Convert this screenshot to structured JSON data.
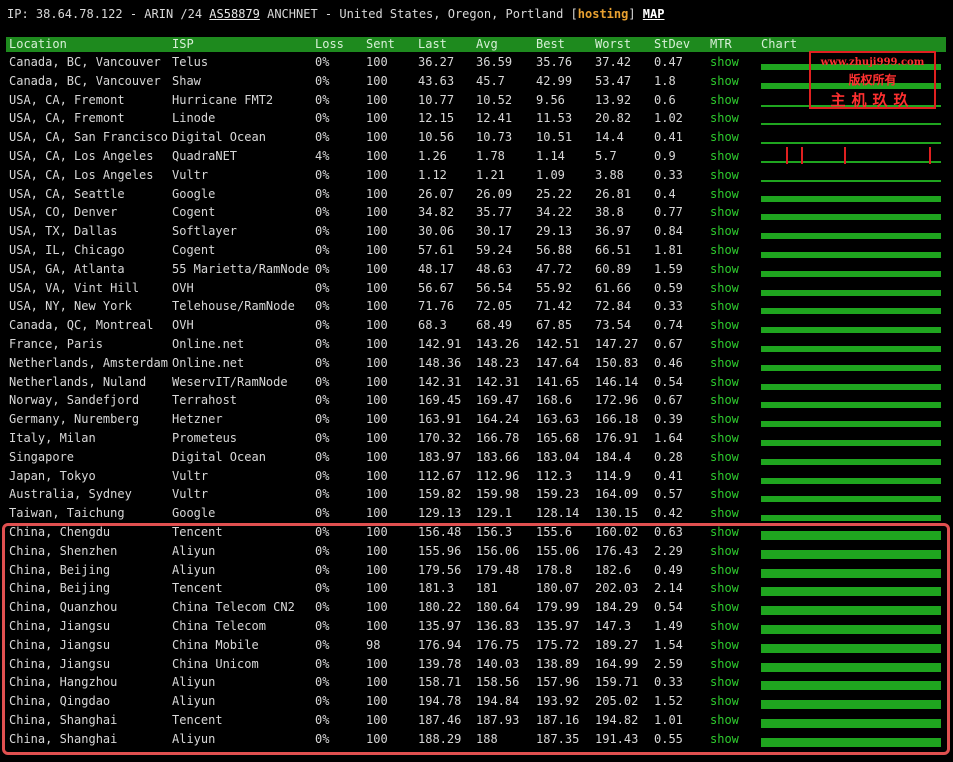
{
  "topline": {
    "prefix": "IP: 38.64.78.122 - ARIN /24 ",
    "asn": "AS58879",
    "mid": " ANCHNET - United States, Oregon, Portland [",
    "tag": "hosting",
    "close": "] ",
    "map": "MAP"
  },
  "headers": {
    "location": "Location",
    "isp": "ISP",
    "loss": "Loss",
    "sent": "Sent",
    "last": "Last",
    "avg": "Avg",
    "best": "Best",
    "worst": "Worst",
    "stdev": "StDev",
    "mtr": "MTR",
    "chart": "Chart"
  },
  "rows": [
    {
      "location": "Canada, BC, Vancouver",
      "isp": "Telus",
      "loss": "0%",
      "sent": "100",
      "last": "36.27",
      "avg": "36.59",
      "best": "35.76",
      "worst": "37.42",
      "stdev": "0.47",
      "mtr": "show"
    },
    {
      "location": "Canada, BC, Vancouver",
      "isp": "Shaw",
      "loss": "0%",
      "sent": "100",
      "last": "43.63",
      "avg": "45.7",
      "best": "42.99",
      "worst": "53.47",
      "stdev": "1.8",
      "mtr": "show"
    },
    {
      "location": "USA, CA, Fremont",
      "isp": "Hurricane FMT2",
      "loss": "0%",
      "sent": "100",
      "last": "10.77",
      "avg": "10.52",
      "best": "9.56",
      "worst": "13.92",
      "stdev": "0.6",
      "mtr": "show"
    },
    {
      "location": "USA, CA, Fremont",
      "isp": "Linode",
      "loss": "0%",
      "sent": "100",
      "last": "12.15",
      "avg": "12.41",
      "best": "11.53",
      "worst": "20.82",
      "stdev": "1.02",
      "mtr": "show"
    },
    {
      "location": "USA, CA, San Francisco",
      "isp": "Digital Ocean",
      "loss": "0%",
      "sent": "100",
      "last": "10.56",
      "avg": "10.73",
      "best": "10.51",
      "worst": "14.4",
      "stdev": "0.41",
      "mtr": "show"
    },
    {
      "location": "USA, CA, Los Angeles",
      "isp": "QuadraNET",
      "loss": "4%",
      "sent": "100",
      "last": "1.26",
      "avg": "1.78",
      "best": "1.14",
      "worst": "5.7",
      "stdev": "0.9",
      "mtr": "show"
    },
    {
      "location": "USA, CA, Los Angeles",
      "isp": "Vultr",
      "loss": "0%",
      "sent": "100",
      "last": "1.12",
      "avg": "1.21",
      "best": "1.09",
      "worst": "3.88",
      "stdev": "0.33",
      "mtr": "show"
    },
    {
      "location": "USA, CA, Seattle",
      "isp": "Google",
      "loss": "0%",
      "sent": "100",
      "last": "26.07",
      "avg": "26.09",
      "best": "25.22",
      "worst": "26.81",
      "stdev": "0.4",
      "mtr": "show"
    },
    {
      "location": "USA, CO, Denver",
      "isp": "Cogent",
      "loss": "0%",
      "sent": "100",
      "last": "34.82",
      "avg": "35.77",
      "best": "34.22",
      "worst": "38.8",
      "stdev": "0.77",
      "mtr": "show"
    },
    {
      "location": "USA, TX, Dallas",
      "isp": "Softlayer",
      "loss": "0%",
      "sent": "100",
      "last": "30.06",
      "avg": "30.17",
      "best": "29.13",
      "worst": "36.97",
      "stdev": "0.84",
      "mtr": "show"
    },
    {
      "location": "USA, IL, Chicago",
      "isp": "Cogent",
      "loss": "0%",
      "sent": "100",
      "last": "57.61",
      "avg": "59.24",
      "best": "56.88",
      "worst": "66.51",
      "stdev": "1.81",
      "mtr": "show"
    },
    {
      "location": "USA, GA, Atlanta",
      "isp": "55 Marietta/RamNode",
      "loss": "0%",
      "sent": "100",
      "last": "48.17",
      "avg": "48.63",
      "best": "47.72",
      "worst": "60.89",
      "stdev": "1.59",
      "mtr": "show"
    },
    {
      "location": "USA, VA, Vint Hill",
      "isp": "OVH",
      "loss": "0%",
      "sent": "100",
      "last": "56.67",
      "avg": "56.54",
      "best": "55.92",
      "worst": "61.66",
      "stdev": "0.59",
      "mtr": "show"
    },
    {
      "location": "USA, NY, New York",
      "isp": "Telehouse/RamNode",
      "loss": "0%",
      "sent": "100",
      "last": "71.76",
      "avg": "72.05",
      "best": "71.42",
      "worst": "72.84",
      "stdev": "0.33",
      "mtr": "show"
    },
    {
      "location": "Canada, QC, Montreal",
      "isp": "OVH",
      "loss": "0%",
      "sent": "100",
      "last": "68.3",
      "avg": "68.49",
      "best": "67.85",
      "worst": "73.54",
      "stdev": "0.74",
      "mtr": "show"
    },
    {
      "location": "France, Paris",
      "isp": "Online.net",
      "loss": "0%",
      "sent": "100",
      "last": "142.91",
      "avg": "143.26",
      "best": "142.51",
      "worst": "147.27",
      "stdev": "0.67",
      "mtr": "show"
    },
    {
      "location": "Netherlands, Amsterdam",
      "isp": "Online.net",
      "loss": "0%",
      "sent": "100",
      "last": "148.36",
      "avg": "148.23",
      "best": "147.64",
      "worst": "150.83",
      "stdev": "0.46",
      "mtr": "show"
    },
    {
      "location": "Netherlands, Nuland",
      "isp": "WeservIT/RamNode",
      "loss": "0%",
      "sent": "100",
      "last": "142.31",
      "avg": "142.31",
      "best": "141.65",
      "worst": "146.14",
      "stdev": "0.54",
      "mtr": "show"
    },
    {
      "location": "Norway, Sandefjord",
      "isp": "Terrahost",
      "loss": "0%",
      "sent": "100",
      "last": "169.45",
      "avg": "169.47",
      "best": "168.6",
      "worst": "172.96",
      "stdev": "0.67",
      "mtr": "show"
    },
    {
      "location": "Germany, Nuremberg",
      "isp": "Hetzner",
      "loss": "0%",
      "sent": "100",
      "last": "163.91",
      "avg": "164.24",
      "best": "163.63",
      "worst": "166.18",
      "stdev": "0.39",
      "mtr": "show"
    },
    {
      "location": "Italy, Milan",
      "isp": "Prometeus",
      "loss": "0%",
      "sent": "100",
      "last": "170.32",
      "avg": "166.78",
      "best": "165.68",
      "worst": "176.91",
      "stdev": "1.64",
      "mtr": "show"
    },
    {
      "location": "Singapore",
      "isp": "Digital Ocean",
      "loss": "0%",
      "sent": "100",
      "last": "183.97",
      "avg": "183.66",
      "best": "183.04",
      "worst": "184.4",
      "stdev": "0.28",
      "mtr": "show"
    },
    {
      "location": "Japan, Tokyo",
      "isp": "Vultr",
      "loss": "0%",
      "sent": "100",
      "last": "112.67",
      "avg": "112.96",
      "best": "112.3",
      "worst": "114.9",
      "stdev": "0.41",
      "mtr": "show"
    },
    {
      "location": "Australia, Sydney",
      "isp": "Vultr",
      "loss": "0%",
      "sent": "100",
      "last": "159.82",
      "avg": "159.98",
      "best": "159.23",
      "worst": "164.09",
      "stdev": "0.57",
      "mtr": "show"
    },
    {
      "location": "Taiwan, Taichung",
      "isp": "Google",
      "loss": "0%",
      "sent": "100",
      "last": "129.13",
      "avg": "129.1",
      "best": "128.14",
      "worst": "130.15",
      "stdev": "0.42",
      "mtr": "show"
    },
    {
      "location": "China, Chengdu",
      "isp": "Tencent",
      "loss": "0%",
      "sent": "100",
      "last": "156.48",
      "avg": "156.3",
      "best": "155.6",
      "worst": "160.02",
      "stdev": "0.63",
      "mtr": "show"
    },
    {
      "location": "China, Shenzhen",
      "isp": "Aliyun",
      "loss": "0%",
      "sent": "100",
      "last": "155.96",
      "avg": "156.06",
      "best": "155.06",
      "worst": "176.43",
      "stdev": "2.29",
      "mtr": "show"
    },
    {
      "location": "China, Beijing",
      "isp": "Aliyun",
      "loss": "0%",
      "sent": "100",
      "last": "179.56",
      "avg": "179.48",
      "best": "178.8",
      "worst": "182.6",
      "stdev": "0.49",
      "mtr": "show"
    },
    {
      "location": "China, Beijing",
      "isp": "Tencent",
      "loss": "0%",
      "sent": "100",
      "last": "181.3",
      "avg": "181",
      "best": "180.07",
      "worst": "202.03",
      "stdev": "2.14",
      "mtr": "show"
    },
    {
      "location": "China, Quanzhou",
      "isp": "China Telecom CN2",
      "loss": "0%",
      "sent": "100",
      "last": "180.22",
      "avg": "180.64",
      "best": "179.99",
      "worst": "184.29",
      "stdev": "0.54",
      "mtr": "show"
    },
    {
      "location": "China, Jiangsu",
      "isp": "China Telecom",
      "loss": "0%",
      "sent": "100",
      "last": "135.97",
      "avg": "136.83",
      "best": "135.97",
      "worst": "147.3",
      "stdev": "1.49",
      "mtr": "show"
    },
    {
      "location": "China, Jiangsu",
      "isp": "China Mobile",
      "loss": "0%",
      "sent": "98",
      "last": "176.94",
      "avg": "176.75",
      "best": "175.72",
      "worst": "189.27",
      "stdev": "1.54",
      "mtr": "show"
    },
    {
      "location": "China, Jiangsu",
      "isp": "China Unicom",
      "loss": "0%",
      "sent": "100",
      "last": "139.78",
      "avg": "140.03",
      "best": "138.89",
      "worst": "164.99",
      "stdev": "2.59",
      "mtr": "show"
    },
    {
      "location": "China, Hangzhou",
      "isp": "Aliyun",
      "loss": "0%",
      "sent": "100",
      "last": "158.71",
      "avg": "158.56",
      "best": "157.96",
      "worst": "159.71",
      "stdev": "0.33",
      "mtr": "show"
    },
    {
      "location": "China, Qingdao",
      "isp": "Aliyun",
      "loss": "0%",
      "sent": "100",
      "last": "194.78",
      "avg": "194.84",
      "best": "193.92",
      "worst": "205.02",
      "stdev": "1.52",
      "mtr": "show"
    },
    {
      "location": "China, Shanghai",
      "isp": "Tencent",
      "loss": "0%",
      "sent": "100",
      "last": "187.46",
      "avg": "187.93",
      "best": "187.16",
      "worst": "194.82",
      "stdev": "1.01",
      "mtr": "show"
    },
    {
      "location": "China, Shanghai",
      "isp": "Aliyun",
      "loss": "0%",
      "sent": "100",
      "last": "188.29",
      "avg": "188",
      "best": "187.35",
      "worst": "191.43",
      "stdev": "0.55",
      "mtr": "show"
    }
  ],
  "watermark": {
    "url": "www.zhuji999.com",
    "line2": "版权所有",
    "line3": "主机玖玖"
  },
  "colors": {
    "background": "#000000",
    "header_bg": "#1e8a1e",
    "link_green": "#2ecc2e",
    "bar_green": "#1fa51f",
    "spike_red": "#e02020",
    "highlight_border": "#e05050",
    "hosting_tag": "#e8a030"
  }
}
